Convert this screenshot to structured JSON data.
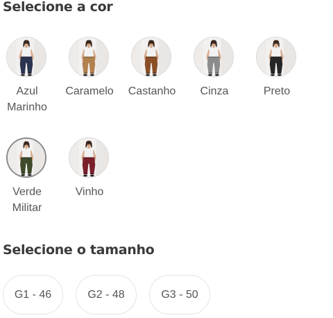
{
  "color_section": {
    "title": "Selecione a cor",
    "selected": "Verde Militar",
    "swatches": [
      {
        "lines": [
          "Azul",
          "Marinho"
        ],
        "pants_color": "#2b3550",
        "selected": false
      },
      {
        "lines": [
          "Caramelo"
        ],
        "pants_color": "#b2814f",
        "selected": false
      },
      {
        "lines": [
          "Castanho"
        ],
        "pants_color": "#8a4f27",
        "selected": false
      },
      {
        "lines": [
          "Cinza"
        ],
        "pants_color": "#8c8c8c",
        "selected": false
      },
      {
        "lines": [
          "Preto"
        ],
        "pants_color": "#262626",
        "selected": false
      },
      {
        "lines": [
          "Verde",
          "Militar"
        ],
        "pants_color": "#3f4a2a",
        "selected": true
      },
      {
        "lines": [
          "Vinho"
        ],
        "pants_color": "#7a1f2b",
        "selected": false
      }
    ]
  },
  "size_section": {
    "title": "Selecione o tamanho",
    "options": [
      "G1 - 46",
      "G2 - 48",
      "G3 - 50"
    ]
  },
  "colors": {
    "heading": "#3a3a3a",
    "label": "#555555",
    "border": "#e3e3e3",
    "selected_border": "#8a8a8a",
    "top": "#f2f2f2",
    "skin": "#d7a98a",
    "hair": "#3b2a22",
    "photo_bg": "#f3f1f0"
  }
}
